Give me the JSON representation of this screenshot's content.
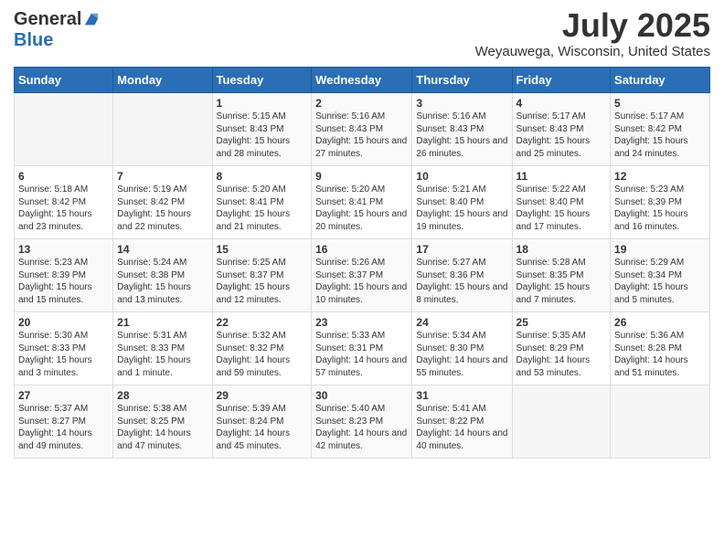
{
  "header": {
    "logo_general": "General",
    "logo_blue": "Blue",
    "month_title": "July 2025",
    "location": "Weyauwega, Wisconsin, United States"
  },
  "columns": [
    "Sunday",
    "Monday",
    "Tuesday",
    "Wednesday",
    "Thursday",
    "Friday",
    "Saturday"
  ],
  "weeks": [
    [
      {
        "day": "",
        "info": ""
      },
      {
        "day": "",
        "info": ""
      },
      {
        "day": "1",
        "info": "Sunrise: 5:15 AM\nSunset: 8:43 PM\nDaylight: 15 hours and 28 minutes."
      },
      {
        "day": "2",
        "info": "Sunrise: 5:16 AM\nSunset: 8:43 PM\nDaylight: 15 hours and 27 minutes."
      },
      {
        "day": "3",
        "info": "Sunrise: 5:16 AM\nSunset: 8:43 PM\nDaylight: 15 hours and 26 minutes."
      },
      {
        "day": "4",
        "info": "Sunrise: 5:17 AM\nSunset: 8:43 PM\nDaylight: 15 hours and 25 minutes."
      },
      {
        "day": "5",
        "info": "Sunrise: 5:17 AM\nSunset: 8:42 PM\nDaylight: 15 hours and 24 minutes."
      }
    ],
    [
      {
        "day": "6",
        "info": "Sunrise: 5:18 AM\nSunset: 8:42 PM\nDaylight: 15 hours and 23 minutes."
      },
      {
        "day": "7",
        "info": "Sunrise: 5:19 AM\nSunset: 8:42 PM\nDaylight: 15 hours and 22 minutes."
      },
      {
        "day": "8",
        "info": "Sunrise: 5:20 AM\nSunset: 8:41 PM\nDaylight: 15 hours and 21 minutes."
      },
      {
        "day": "9",
        "info": "Sunrise: 5:20 AM\nSunset: 8:41 PM\nDaylight: 15 hours and 20 minutes."
      },
      {
        "day": "10",
        "info": "Sunrise: 5:21 AM\nSunset: 8:40 PM\nDaylight: 15 hours and 19 minutes."
      },
      {
        "day": "11",
        "info": "Sunrise: 5:22 AM\nSunset: 8:40 PM\nDaylight: 15 hours and 17 minutes."
      },
      {
        "day": "12",
        "info": "Sunrise: 5:23 AM\nSunset: 8:39 PM\nDaylight: 15 hours and 16 minutes."
      }
    ],
    [
      {
        "day": "13",
        "info": "Sunrise: 5:23 AM\nSunset: 8:39 PM\nDaylight: 15 hours and 15 minutes."
      },
      {
        "day": "14",
        "info": "Sunrise: 5:24 AM\nSunset: 8:38 PM\nDaylight: 15 hours and 13 minutes."
      },
      {
        "day": "15",
        "info": "Sunrise: 5:25 AM\nSunset: 8:37 PM\nDaylight: 15 hours and 12 minutes."
      },
      {
        "day": "16",
        "info": "Sunrise: 5:26 AM\nSunset: 8:37 PM\nDaylight: 15 hours and 10 minutes."
      },
      {
        "day": "17",
        "info": "Sunrise: 5:27 AM\nSunset: 8:36 PM\nDaylight: 15 hours and 8 minutes."
      },
      {
        "day": "18",
        "info": "Sunrise: 5:28 AM\nSunset: 8:35 PM\nDaylight: 15 hours and 7 minutes."
      },
      {
        "day": "19",
        "info": "Sunrise: 5:29 AM\nSunset: 8:34 PM\nDaylight: 15 hours and 5 minutes."
      }
    ],
    [
      {
        "day": "20",
        "info": "Sunrise: 5:30 AM\nSunset: 8:33 PM\nDaylight: 15 hours and 3 minutes."
      },
      {
        "day": "21",
        "info": "Sunrise: 5:31 AM\nSunset: 8:33 PM\nDaylight: 15 hours and 1 minute."
      },
      {
        "day": "22",
        "info": "Sunrise: 5:32 AM\nSunset: 8:32 PM\nDaylight: 14 hours and 59 minutes."
      },
      {
        "day": "23",
        "info": "Sunrise: 5:33 AM\nSunset: 8:31 PM\nDaylight: 14 hours and 57 minutes."
      },
      {
        "day": "24",
        "info": "Sunrise: 5:34 AM\nSunset: 8:30 PM\nDaylight: 14 hours and 55 minutes."
      },
      {
        "day": "25",
        "info": "Sunrise: 5:35 AM\nSunset: 8:29 PM\nDaylight: 14 hours and 53 minutes."
      },
      {
        "day": "26",
        "info": "Sunrise: 5:36 AM\nSunset: 8:28 PM\nDaylight: 14 hours and 51 minutes."
      }
    ],
    [
      {
        "day": "27",
        "info": "Sunrise: 5:37 AM\nSunset: 8:27 PM\nDaylight: 14 hours and 49 minutes."
      },
      {
        "day": "28",
        "info": "Sunrise: 5:38 AM\nSunset: 8:25 PM\nDaylight: 14 hours and 47 minutes."
      },
      {
        "day": "29",
        "info": "Sunrise: 5:39 AM\nSunset: 8:24 PM\nDaylight: 14 hours and 45 minutes."
      },
      {
        "day": "30",
        "info": "Sunrise: 5:40 AM\nSunset: 8:23 PM\nDaylight: 14 hours and 42 minutes."
      },
      {
        "day": "31",
        "info": "Sunrise: 5:41 AM\nSunset: 8:22 PM\nDaylight: 14 hours and 40 minutes."
      },
      {
        "day": "",
        "info": ""
      },
      {
        "day": "",
        "info": ""
      }
    ]
  ]
}
